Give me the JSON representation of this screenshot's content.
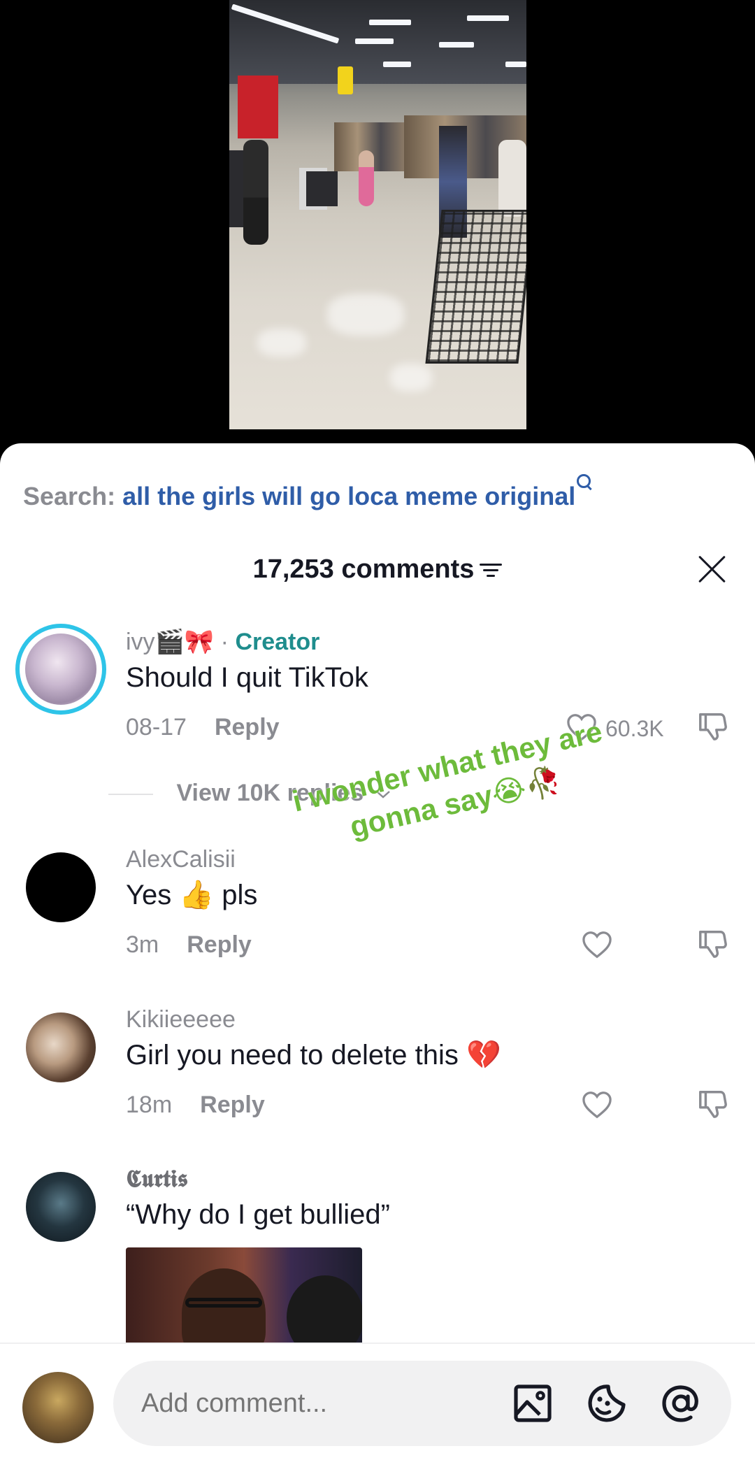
{
  "search": {
    "label": "Search:",
    "query": "all the girls will go loca meme original"
  },
  "header": {
    "count_label": "17,253 comments"
  },
  "comments": [
    {
      "username": "ivy🎬🎀",
      "separator": " · ",
      "tag": "Creator",
      "text": "Should I quit TikTok",
      "time": "08-17",
      "reply_label": "Reply",
      "likes": "60.3K"
    },
    {
      "username": "AlexCalisii",
      "text": "Yes 👍 pls",
      "time": "3m",
      "reply_label": "Reply"
    },
    {
      "username": "Kikiieeeee",
      "text": "Girl you need to delete this 💔",
      "time": "18m",
      "reply_label": "Reply"
    },
    {
      "username": "𝕮𝖚𝖗𝖙𝖎𝖘",
      "text": "“Why do I get bullied”"
    }
  ],
  "view_replies": "View 10K replies",
  "overlay": {
    "text": "i wonder what they are gonna say😭🥀",
    "color": "#6dbb3b"
  },
  "composer": {
    "placeholder": "Add comment..."
  },
  "colors": {
    "creator_tag": "#1f8d8d",
    "search_query": "#2f5da8",
    "muted": "#8a8b91",
    "text": "#161823",
    "avatar_ring": "#2ec4e8"
  },
  "icons": [
    "search-icon",
    "filter-icon",
    "close-icon",
    "heart-icon",
    "dislike-icon",
    "image-icon",
    "emoji-icon",
    "mention-icon"
  ]
}
